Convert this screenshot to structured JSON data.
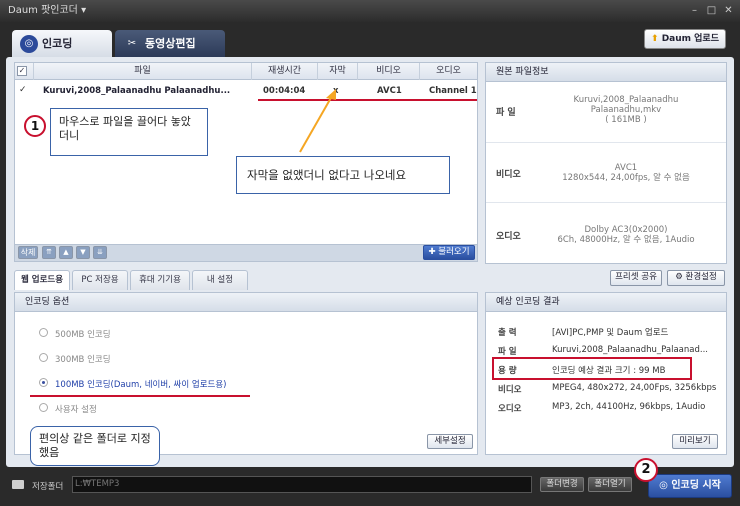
{
  "window": {
    "title": "Daum 팟인코더 ▾",
    "min": "–",
    "max": "□",
    "close": "✕"
  },
  "tabs": [
    {
      "label": "인코딩",
      "icon": "encode-disc-icon"
    },
    {
      "label": "동영상편집",
      "icon": "edit-scissors-icon"
    }
  ],
  "daum_upload": {
    "label": "Daum 업로드",
    "icon": "upload-arrow-icon"
  },
  "file_table": {
    "columns": [
      "파일",
      "재생시간",
      "자막",
      "비디오",
      "오디오"
    ],
    "rows": [
      {
        "file": "Kuruvi,2008_Palaanadhu Palaanadhu...",
        "duration": "00:04:04",
        "subtitle": "x",
        "video": "AVC1",
        "audio": "Channel 1"
      }
    ]
  },
  "file_actions": {
    "delete": "삭제",
    "up_top": "⇈",
    "up": "▲",
    "down": "▼",
    "down_bottom": "⇊",
    "load": "불러오기"
  },
  "source_info": {
    "title": "원본 파일정보",
    "file_label": "파 일",
    "file_value": [
      "Kuruvi,2008_Palaanadhu",
      "Palaanadhu,mkv",
      "( 161MB )"
    ],
    "video_label": "비디오",
    "video_value": [
      "AVC1",
      "1280x544, 24,00fps, 알 수 없음"
    ],
    "audio_label": "오디오",
    "audio_value": [
      "Dolby AC3(0x2000)",
      "6Ch, 48000Hz, 알 수 없음, 1Audio"
    ]
  },
  "preset_buttons": {
    "share": "프리셋 공유",
    "settings": "환경설정"
  },
  "bottom_tabs": [
    "웹 업로드용",
    "PC 저장용",
    "휴대 기기용",
    "내 설정"
  ],
  "encode_options": {
    "title": "인코딩 옵션",
    "options": [
      {
        "label": "500MB 인코딩",
        "selected": false
      },
      {
        "label": "300MB 인코딩",
        "selected": false
      },
      {
        "label": "100MB 인코딩(Daum, 네이버, 싸이 업로드용)",
        "selected": true
      },
      {
        "label": "사용자 설정",
        "selected": false
      }
    ],
    "detail_button": "세부설정"
  },
  "expected_result": {
    "title": "예상 인코딩 결과",
    "rows": [
      {
        "k": "출 력",
        "v": "[AVI]PC,PMP 및 Daum 업로드"
      },
      {
        "k": "파 일",
        "v": "Kuruvi,2008_Palaanadhu_Palaanad..."
      },
      {
        "k": "용 량",
        "v": "인코딩 예상 결과 크기 : 99 MB"
      },
      {
        "k": "비디오",
        "v": "MPEG4, 480x272, 24,00Fps, 3256kbps"
      },
      {
        "k": "오디오",
        "v": "MP3, 2ch, 44100Hz, 96kbps, 1Audio"
      }
    ],
    "preview_button": "미리보기"
  },
  "save_folder": {
    "label": "저장폴더",
    "path": "L:₩TEMP3",
    "change": "폴더변경",
    "open": "폴더열기"
  },
  "start_button": "인코딩 시작",
  "annotations": {
    "n1": "1",
    "callout1": "마우스로 파일을 끌어다 놓았더니",
    "callout_subtitle": "자막을 없앴더니 없다고 나오네요",
    "callout_folder": "편의상 같은 폴더로 지정했음",
    "n2": "2"
  },
  "colors": {
    "accent": "#2b4fa0",
    "annotation_red": "#c8102e",
    "arrow": "#f5a623"
  }
}
